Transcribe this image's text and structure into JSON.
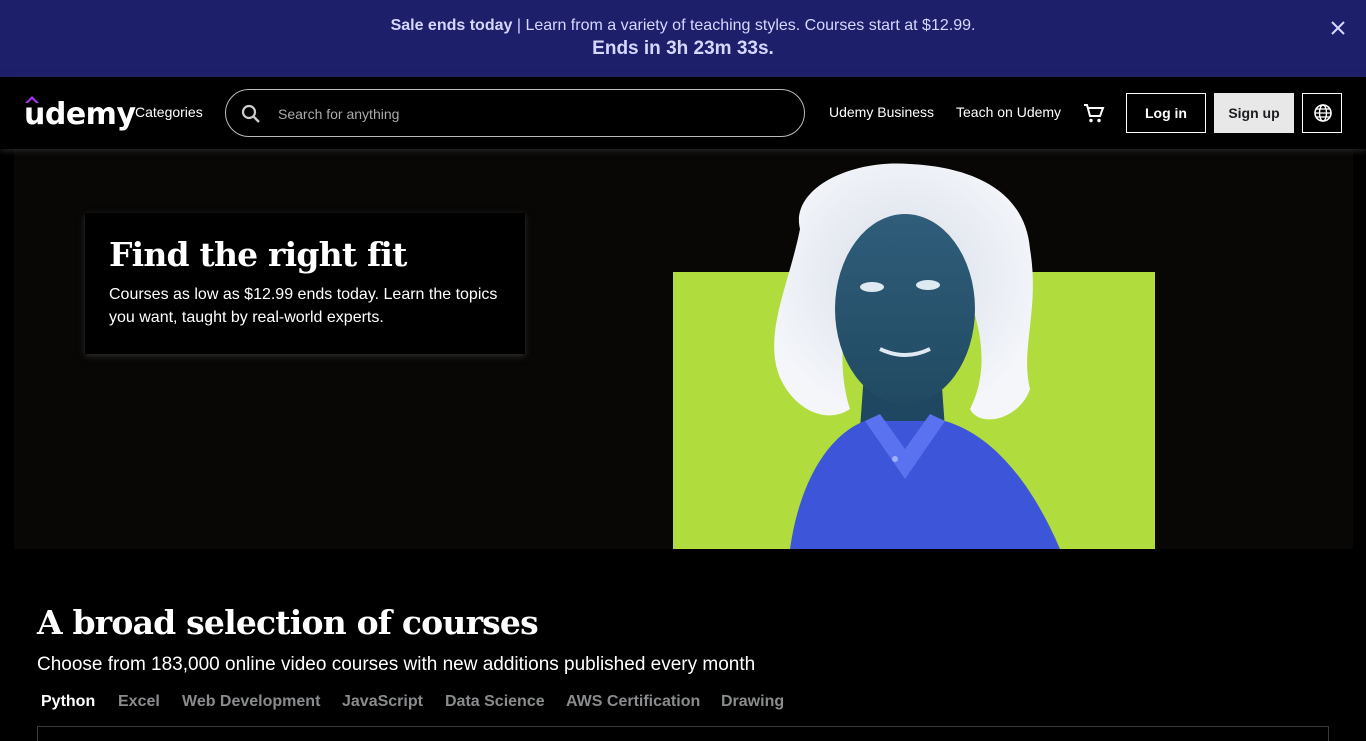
{
  "banner": {
    "bold": "Sale ends today",
    "text": " | Learn from a variety of teaching styles. Courses start at $12.99.",
    "countdown": "Ends in 3h 23m 33s.",
    "close_icon": "close-icon"
  },
  "header": {
    "logo_text": "udemy",
    "categories": "Categories",
    "search_placeholder": "Search for anything",
    "business": "Udemy Business",
    "teach": "Teach on Udemy",
    "login": "Log in",
    "signup": "Sign up",
    "icons": [
      "search-icon",
      "cart-icon",
      "globe-icon"
    ]
  },
  "hero": {
    "title": "Find the right fit",
    "text": "Courses as low as $12.99 ends today. Learn the topics you want, taught by real-world experts."
  },
  "section": {
    "title": "A broad selection of courses",
    "subtitle": "Choose from 183,000 online video courses with new additions published every month",
    "tabs": [
      "Python",
      "Excel",
      "Web Development",
      "JavaScript",
      "Data Science",
      "AWS Certification",
      "Drawing"
    ],
    "active_tab": "Python"
  },
  "colors": {
    "banner_bg": "#1e1f6b",
    "accent_green": "#b0dc3e",
    "background": "#000000"
  }
}
